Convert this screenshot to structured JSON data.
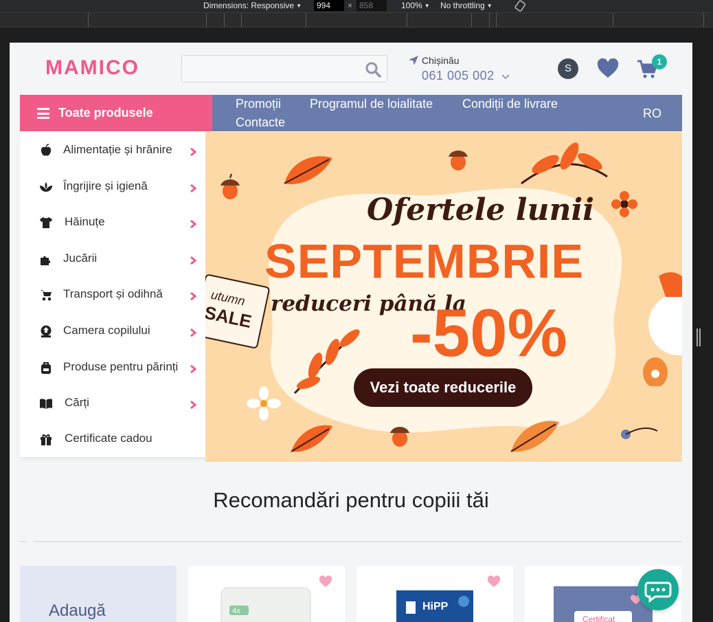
{
  "devtools": {
    "dimensions_label": "Dimensions: Responsive",
    "width": "994",
    "height": "858",
    "zoom": "100%",
    "throttling": "No throttling"
  },
  "header": {
    "logo": "MAMICO",
    "search_placeholder": "",
    "city": "Chișinău",
    "phone": "061 005 002",
    "user_initial": "S",
    "cart_count": "1"
  },
  "nav": {
    "all_products": "Toate produsele",
    "links": [
      "Promoții",
      "Programul de loialitate",
      "Condiții de livrare",
      "Contacte"
    ],
    "language": "RO"
  },
  "menu": {
    "items": [
      {
        "label": "Alimentație și hrănire",
        "icon": "apple-icon"
      },
      {
        "label": "Îngrijire și igienă",
        "icon": "lotus-icon"
      },
      {
        "label": "Hăinuțe",
        "icon": "tshirt-icon"
      },
      {
        "label": "Jucării",
        "icon": "puzzle-icon"
      },
      {
        "label": "Transport și odihnă",
        "icon": "stroller-icon"
      },
      {
        "label": "Camera copilului",
        "icon": "crib-icon"
      },
      {
        "label": "Produse pentru părinți",
        "icon": "backpack-icon"
      },
      {
        "label": "Cărți",
        "icon": "book-icon"
      },
      {
        "label": "Certificate cadou",
        "icon": "gift-icon"
      }
    ]
  },
  "banner": {
    "script_line": "Ofertele lunii",
    "month": "SEPTEMBRIE",
    "discount_line": "reduceri până la",
    "percent": "-50%",
    "cta": "Vezi toate reducerile",
    "tag_line1": "utumn",
    "tag_line2": "SALE"
  },
  "recommendations": {
    "title": "Recomandări pentru copiii tăi",
    "add_card": "Adaugă",
    "product_labels": [
      "4x",
      "HiPP",
      "Certificat"
    ]
  },
  "colors": {
    "brand_pink": "#f05b87",
    "nav_blue": "#6a7cab",
    "teal": "#22b3a3",
    "banner_orange": "#f26222"
  }
}
